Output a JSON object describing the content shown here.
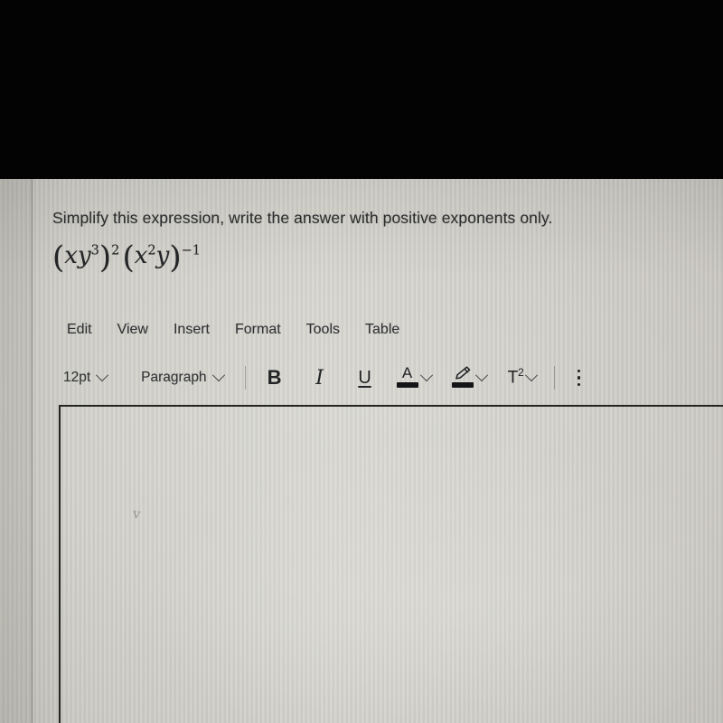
{
  "screen": {
    "letterbox_color": "#030303",
    "page_background": "#d0cfc8"
  },
  "question": {
    "prompt": "Simplify this expression, write the answer with positive exponents only.",
    "expression_plain": "(xy^3)^2 (x^2 y)^-1",
    "expression_parts": {
      "group1": {
        "open": "(",
        "base1": "x",
        "base2": "y",
        "exp2": "3",
        "close": ")",
        "outer_exp": "2"
      },
      "group2": {
        "open": "(",
        "base1": "x",
        "exp1": "2",
        "base2": "y",
        "close": ")",
        "outer_exp": "−1"
      }
    }
  },
  "editor": {
    "menubar": [
      {
        "label": "Edit",
        "name": "menu-edit"
      },
      {
        "label": "View",
        "name": "menu-view"
      },
      {
        "label": "Insert",
        "name": "menu-insert"
      },
      {
        "label": "Format",
        "name": "menu-format"
      },
      {
        "label": "Tools",
        "name": "menu-tools"
      },
      {
        "label": "Table",
        "name": "menu-table"
      }
    ],
    "toolbar": {
      "font_size": "12pt",
      "block_format": "Paragraph",
      "bold_label": "B",
      "italic_label": "I",
      "underline_label": "U",
      "text_color_label": "A",
      "highlight_label": "✎",
      "superscript_label": "T",
      "superscript_exp": "2",
      "more_label": "⋮"
    },
    "body": {
      "content": "",
      "placeholder": ""
    }
  }
}
